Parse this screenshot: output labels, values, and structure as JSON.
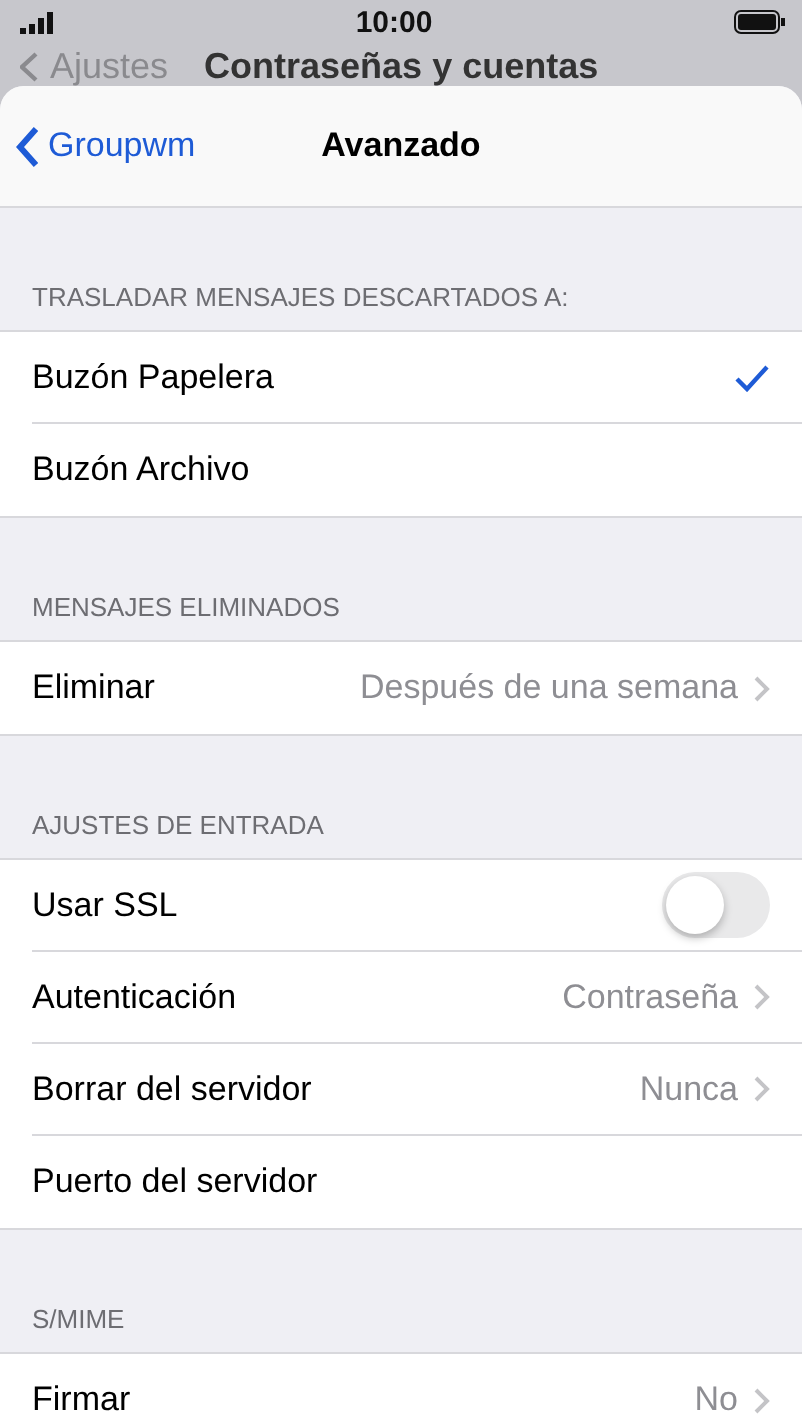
{
  "status_bar": {
    "time": "10:00"
  },
  "background_nav": {
    "back": "Ajustes",
    "title": "Contraseñas y cuentas"
  },
  "nav": {
    "back": "Groupwm",
    "title": "Avanzado"
  },
  "sections": [
    {
      "header": "TRASLADAR MENSAJES DESCARTADOS A:",
      "rows": [
        {
          "kind": "choice",
          "label": "Buzón Papelera",
          "selected": true
        },
        {
          "kind": "choice",
          "label": "Buzón Archivo",
          "selected": false
        }
      ]
    },
    {
      "header": "MENSAJES ELIMINADOS",
      "rows": [
        {
          "kind": "detail",
          "label": "Eliminar",
          "value": "Después de una semana"
        }
      ]
    },
    {
      "header": "AJUSTES DE ENTRADA",
      "rows": [
        {
          "kind": "toggle",
          "label": "Usar SSL",
          "on": false
        },
        {
          "kind": "detail",
          "label": "Autenticación",
          "value": "Contraseña"
        },
        {
          "kind": "detail",
          "label": "Borrar del servidor",
          "value": "Nunca"
        },
        {
          "kind": "plain",
          "label": "Puerto del servidor"
        }
      ]
    },
    {
      "header": "S/MIME",
      "rows": [
        {
          "kind": "detail",
          "label": "Firmar",
          "value": "No"
        }
      ]
    }
  ]
}
